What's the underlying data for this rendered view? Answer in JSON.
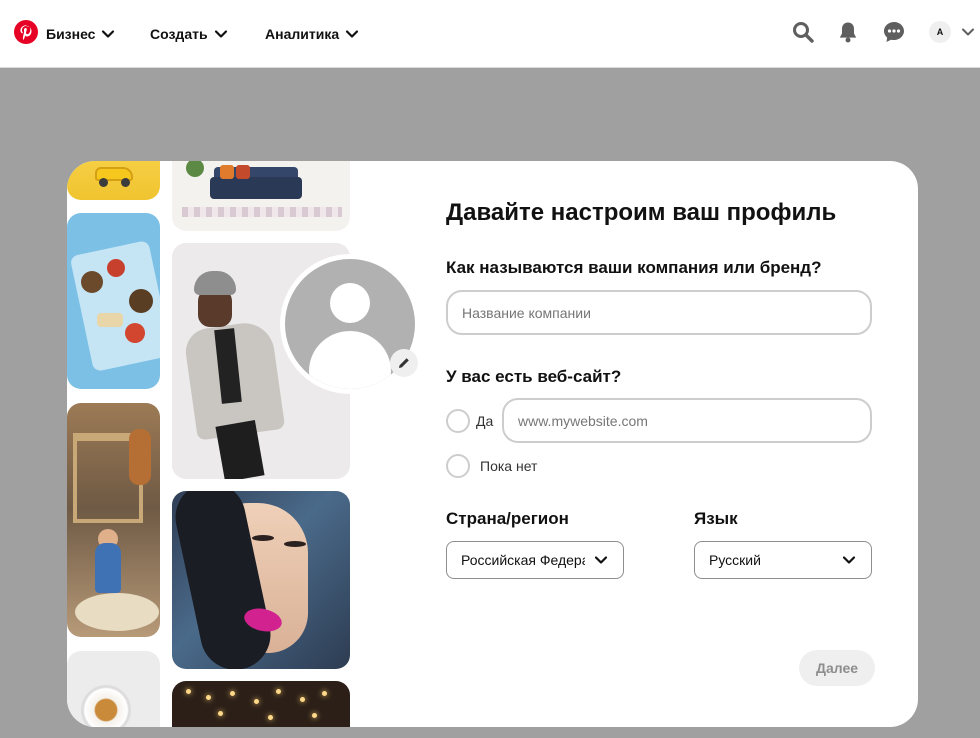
{
  "topbar": {
    "logo_icon": "pinterest-logo",
    "brand_color": "#e60023",
    "nav": [
      {
        "label": "Бизнес"
      },
      {
        "label": "Создать"
      },
      {
        "label": "Аналитика"
      }
    ],
    "icons": [
      "search-icon",
      "bell-icon",
      "messages-icon"
    ],
    "avatar_letter": "A"
  },
  "onboarding": {
    "title": "Давайте настроим ваш профиль",
    "company": {
      "label": "Как называются ваши компания или бренд?",
      "placeholder": "Название компании",
      "value": ""
    },
    "website": {
      "label": "У вас есть веб-сайт?",
      "yes_label": "Да",
      "no_label": "Пока нет",
      "placeholder": "www.mywebsite.com",
      "value": ""
    },
    "country": {
      "label": "Страна/регион",
      "value": "Российская Федерация"
    },
    "language": {
      "label": "Язык",
      "value": "Русский"
    },
    "next_button": "Далее",
    "profile_photo_icon": "default-avatar-icon",
    "edit_icon": "pencil-icon"
  },
  "colors": {
    "overlay": "#a0a0a0",
    "input_border": "#cdcdcd",
    "button_disabled_bg": "#efefef",
    "button_disabled_text": "#8e8e8e"
  }
}
